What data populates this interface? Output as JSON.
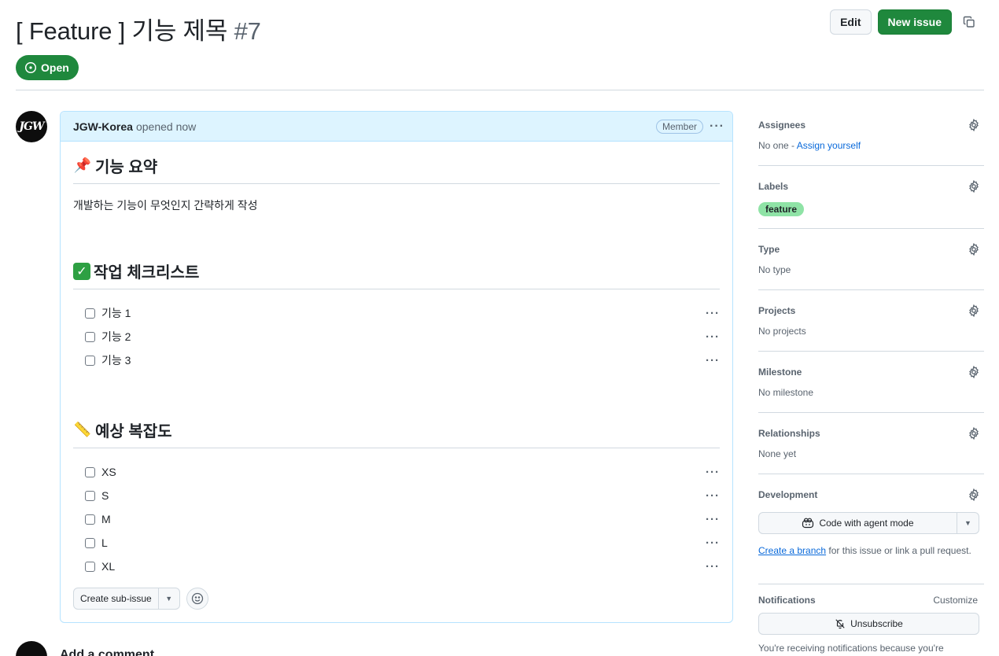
{
  "header": {
    "title": "[ Feature ] 기능 제목",
    "number": "#7",
    "edit_label": "Edit",
    "new_issue_label": "New issue",
    "state_label": "Open"
  },
  "comment": {
    "author": "JGW-Korea",
    "opened_text": "opened now",
    "role_badge": "Member",
    "avatar_text": "JGW",
    "section1": {
      "emoji": "📌",
      "title": "기능 요약",
      "text": "개발하는 기능이 무엇인지 간략하게 작성"
    },
    "section2": {
      "emoji": "✓",
      "title": "작업 체크리스트",
      "tasks": [
        "기능 1",
        "기능 2",
        "기능 3"
      ]
    },
    "section3": {
      "emoji": "📏",
      "title": "예상 복잡도",
      "tasks": [
        "XS",
        "S",
        "M",
        "L",
        "XL"
      ]
    },
    "create_sub_issue_label": "Create sub-issue"
  },
  "add_comment": {
    "title": "Add a comment"
  },
  "sidebar": {
    "assignees": {
      "title": "Assignees",
      "value": "No one - ",
      "link": "Assign yourself"
    },
    "labels": {
      "title": "Labels",
      "label": "feature",
      "label_color": "#8fe3a6"
    },
    "type": {
      "title": "Type",
      "value": "No type"
    },
    "projects": {
      "title": "Projects",
      "value": "No projects"
    },
    "milestone": {
      "title": "Milestone",
      "value": "No milestone"
    },
    "relationships": {
      "title": "Relationships",
      "value": "None yet"
    },
    "development": {
      "title": "Development",
      "agent_button": "Code with agent mode",
      "link": "Create a branch",
      "text": " for this issue or link a pull request."
    },
    "notifications": {
      "title": "Notifications",
      "customize": "Customize",
      "unsubscribe": "Unsubscribe",
      "note": "You're receiving notifications because you're"
    }
  },
  "colors": {
    "accent_green": "#1f883d",
    "link_blue": "#0969da",
    "comment_header_bg": "#ddf4ff",
    "border": "#d1d9e0"
  }
}
